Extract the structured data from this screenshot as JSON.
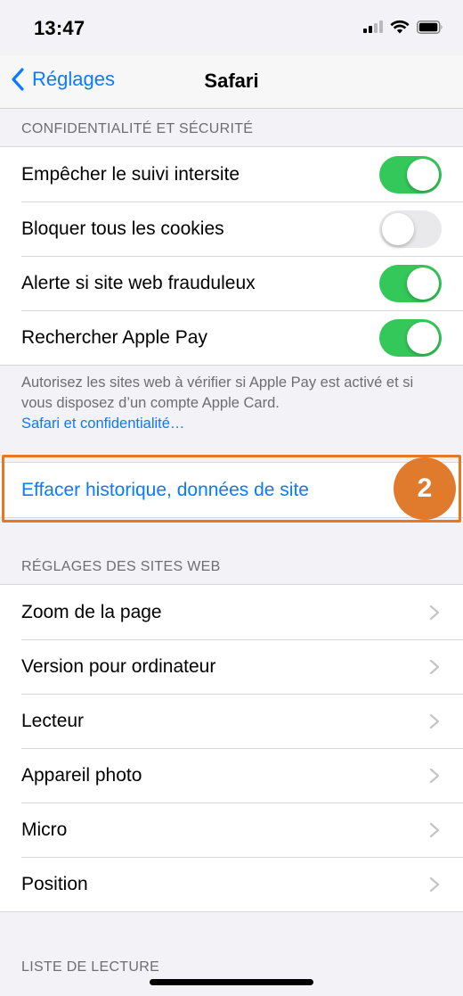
{
  "status_bar": {
    "time": "13:47"
  },
  "nav": {
    "back_label": "Réglages",
    "title": "Safari"
  },
  "privacy": {
    "header": "CONFIDENTIALITÉ ET SÉCURITÉ",
    "rows": [
      {
        "label": "Empêcher le suivi intersite",
        "on": true
      },
      {
        "label": "Bloquer tous les cookies",
        "on": false
      },
      {
        "label": "Alerte si site web frauduleux",
        "on": true
      },
      {
        "label": "Rechercher Apple Pay",
        "on": true
      }
    ],
    "footer_text": "Autorisez les sites web à vérifier si Apple Pay est activé et si vous disposez d’un compte Apple Card.",
    "footer_link": "Safari et confidentialité…"
  },
  "clear": {
    "label": "Effacer historique, données de site",
    "step_number": "2"
  },
  "website_settings": {
    "header": "RÉGLAGES DES SITES WEB",
    "rows": [
      {
        "label": "Zoom de la page"
      },
      {
        "label": "Version pour ordinateur"
      },
      {
        "label": "Lecteur"
      },
      {
        "label": "Appareil photo"
      },
      {
        "label": "Micro"
      },
      {
        "label": "Position"
      }
    ]
  },
  "reading_list": {
    "header": "LISTE DE LECTURE"
  },
  "colors": {
    "accent": "#0a7aff",
    "toggle_on": "#34c759",
    "highlight": "#e87722"
  }
}
